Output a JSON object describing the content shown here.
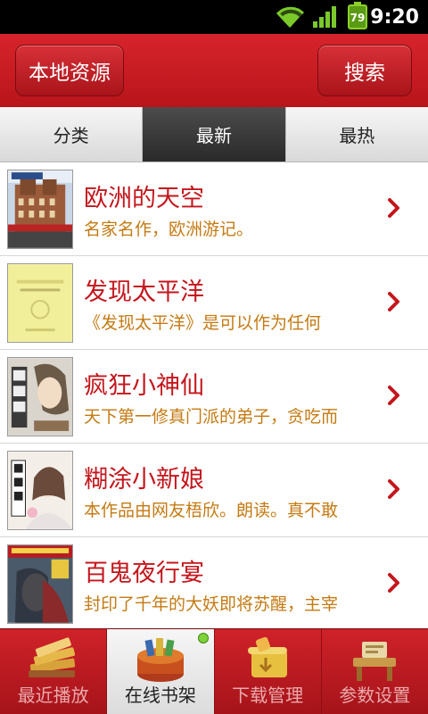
{
  "status": {
    "battery": "79",
    "time": "9:20"
  },
  "header": {
    "left_button": "本地资源",
    "right_button": "搜索"
  },
  "tabs": [
    {
      "label": "分类",
      "active": false
    },
    {
      "label": "最新",
      "active": true
    },
    {
      "label": "最热",
      "active": false
    }
  ],
  "books": [
    {
      "title": "欧洲的天空",
      "desc": "名家名作，欧洲游记。",
      "cover": "building-cover"
    },
    {
      "title": "发现太平洋",
      "desc": "《发现太平洋》是可以作为任何",
      "cover": "yellow-cover"
    },
    {
      "title": "疯狂小神仙",
      "desc": "天下第一修真门派的弟子，贪吃而",
      "cover": "anime-cover"
    },
    {
      "title": "糊涂小新娘",
      "desc": "本作品由网友梧欣。朗读。真不敢",
      "cover": "bride-cover"
    },
    {
      "title": "百鬼夜行宴",
      "desc": "封印了千年的大妖即将苏醒，主宰",
      "cover": "ghost-cover"
    }
  ],
  "bottom_nav": [
    {
      "label": "最近播放",
      "icon": "books-icon",
      "active": false
    },
    {
      "label": "在线书架",
      "icon": "bookshelf-icon",
      "active": true
    },
    {
      "label": "下载管理",
      "icon": "download-scroll-icon",
      "active": false
    },
    {
      "label": "参数设置",
      "icon": "desk-settings-icon",
      "active": false
    }
  ],
  "colors": {
    "brand_red": "#c4161c",
    "desc_orange": "#c47a12"
  }
}
